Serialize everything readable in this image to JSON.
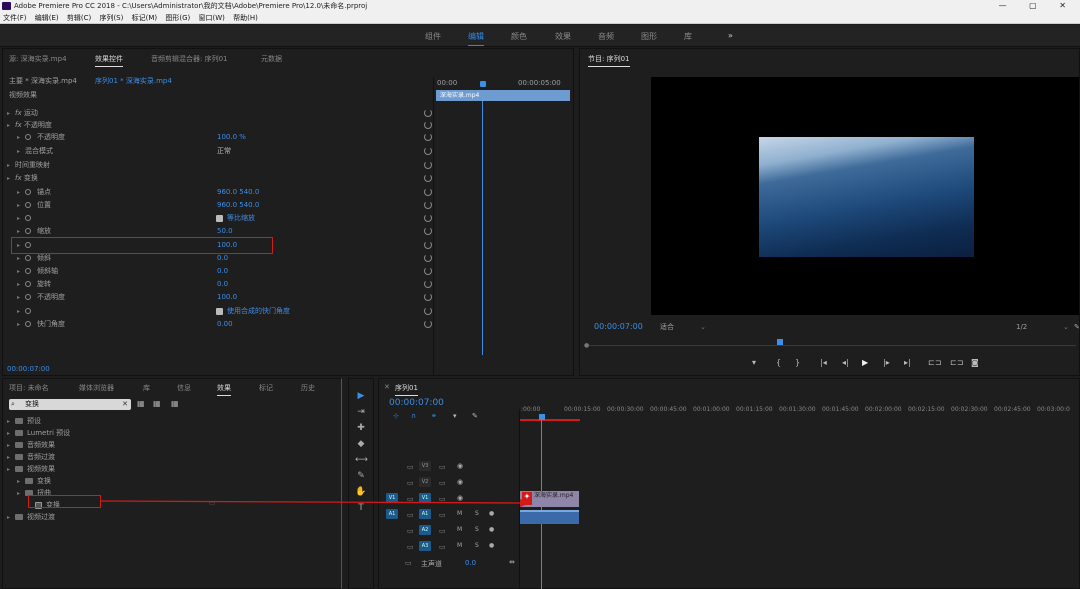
{
  "window": {
    "title": "Adobe Premiere Pro CC 2018 - C:\\Users\\Administrator\\我的文档\\Adobe\\Premiere Pro\\12.0\\未命名.prproj",
    "controls": "— ▢ ✕"
  },
  "menu": [
    "文件(F)",
    "编辑(E)",
    "剪辑(C)",
    "序列(S)",
    "标记(M)",
    "图形(G)",
    "窗口(W)",
    "帮助(H)"
  ],
  "workspaces": [
    "组件",
    "编辑",
    "颜色",
    "效果",
    "音频",
    "图形",
    "库"
  ],
  "workspace_more": "»",
  "effect_controls": {
    "tabs": [
      "源: 深海实录.mp4",
      "效果控件",
      "音频剪辑混合器: 序列01",
      "元数据"
    ],
    "source_path": "主要 * 深海实录.mp4",
    "sequence_path": "序列01 * 深海实录.mp4",
    "timecodes": [
      "00:00",
      "00:00:05:00"
    ],
    "clip_label": "深海实录.mp4",
    "section": "视频效果",
    "rows": [
      {
        "label": "运动"
      },
      {
        "label": "不透明度"
      },
      {
        "label": "不透明度",
        "value": "100.0 %"
      },
      {
        "label": "混合模式",
        "value": "正常"
      },
      {
        "label": "时间重映射"
      },
      {
        "label": "变换"
      },
      {
        "label": "锚点",
        "value": "960.0    540.0"
      },
      {
        "label": "位置",
        "value": "960.0    540.0"
      },
      {
        "label": "",
        "value": "等比缩放"
      },
      {
        "label": "缩放",
        "value": "50.0"
      },
      {
        "label": "",
        "value": "100.0"
      },
      {
        "label": "倾斜",
        "value": "0.0"
      },
      {
        "label": "倾斜轴",
        "value": "0.0"
      },
      {
        "label": "旋转",
        "value": "0.0"
      },
      {
        "label": "不透明度",
        "value": "100.0"
      },
      {
        "label": "",
        "value": "使用合成的快门角度"
      },
      {
        "label": "快门角度",
        "value": "0.00"
      }
    ],
    "bottom_timecode": "00:00:07:00"
  },
  "program": {
    "title": "节目: 序列01",
    "timecode": "00:00:07:00",
    "fit": "适合",
    "scale": "1/2"
  },
  "effects_panel": {
    "tabs": [
      "项目: 未命名",
      "媒体浏览器",
      "库",
      "信息",
      "效果",
      "标记",
      "历史"
    ],
    "search": "变换",
    "tree": [
      {
        "label": "预设",
        "indent": 0
      },
      {
        "label": "Lumetri 预设",
        "indent": 0
      },
      {
        "label": "音频效果",
        "indent": 0
      },
      {
        "label": "音频过渡",
        "indent": 0
      },
      {
        "label": "视频效果",
        "indent": 0
      },
      {
        "label": "变换",
        "indent": 1
      },
      {
        "label": "扭曲",
        "indent": 1
      },
      {
        "label": "变换",
        "indent": 2
      },
      {
        "label": "视频过渡",
        "indent": 0
      }
    ]
  },
  "timeline": {
    "tab": "序列01",
    "timecode": "00:00:07:00",
    "ruler": [
      ":00:00",
      "00:00:15:00",
      "00:00:30:00",
      "00:00:45:00",
      "00:01:00:00",
      "00:01:15:00",
      "00:01:30:00",
      "00:01:45:00",
      "00:02:00:00",
      "00:02:15:00",
      "00:02:30:00",
      "00:02:45:00",
      "00:03:00:0"
    ],
    "video_tracks": [
      "V3",
      "V2",
      "V1"
    ],
    "audio_tracks": [
      "A1",
      "A2",
      "A3"
    ],
    "master": "主声道",
    "master_value": "0.0",
    "clip_label": "深海实录.mp4",
    "v_label": "V1",
    "toggles": [
      "M",
      "S"
    ]
  }
}
